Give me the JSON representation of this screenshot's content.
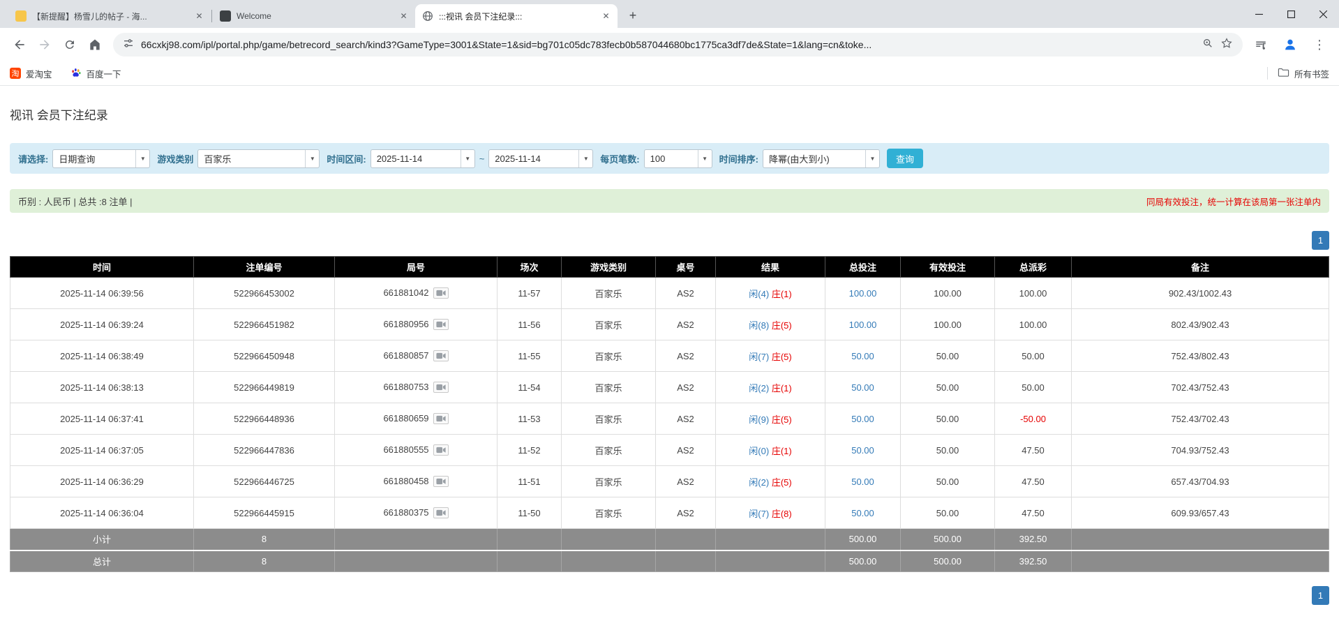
{
  "browser": {
    "tabs": [
      {
        "title": "【新提醒】杨雪儿的帖子 - 海...",
        "active": false
      },
      {
        "title": "Welcome",
        "active": false
      },
      {
        "title": ":::视讯 会员下注纪录:::",
        "active": true
      }
    ],
    "url": "66cxkj98.com/ipl/portal.php/game/betrecord_search/kind3?GameType=3001&State=1&sid=bg701c05dc783fecb0b587044680bc1775ca3df7de&State=1&lang=cn&toke...",
    "bookmarks": {
      "aitaobao_label": "爱淘宝",
      "aitaobao_glyph": "淘",
      "baidu_label": "百度一下",
      "all_bookmarks_label": "所有书签"
    }
  },
  "icons": {
    "tab_close": "✕",
    "new_tab": "+",
    "combo_arrow": "▼",
    "menu_dots": "⋮"
  },
  "page": {
    "title": "视讯 会员下注纪录",
    "filters": {
      "select_label": "请选择:",
      "select_value": "日期查询",
      "game_type_label": "游戏类别",
      "game_type_value": "百家乐",
      "range_label": "时间区间:",
      "date_from": "2025-11-14",
      "range_separator": "~",
      "date_to": "2025-11-14",
      "per_page_label": "每页笔数:",
      "per_page_value": "100",
      "sort_label": "时间排序:",
      "sort_value": "降幂(由大到小)",
      "search_button_label": "查询"
    },
    "info": {
      "summary": "币别 : 人民币 | 总共 :8 注单 |",
      "notice": "同局有效投注，统一计算在该局第一张注单内"
    },
    "pagination_label": "1",
    "colors": {
      "link_blue": "#337ab7",
      "banker_red": "#e60000",
      "negative_red": "#e60000",
      "filter_bg": "#d9edf7",
      "info_bg": "#dff0d8",
      "search_button_bg": "#31b0d5",
      "table_header_bg": "#000000",
      "summary_row_bg": "#8c8c8c",
      "pager_bg": "#337ab7"
    },
    "table": {
      "headers": [
        "时间",
        "注单编号",
        "局号",
        "场次",
        "游戏类别",
        "桌号",
        "结果",
        "总投注",
        "有效投注",
        "总派彩",
        "备注"
      ],
      "rows": [
        {
          "time": "2025-11-14 06:39:56",
          "bet_id": "522966453002",
          "round_id": "661881042",
          "session": "11-57",
          "game": "百家乐",
          "table_no": "AS2",
          "result_player": "闲(4)",
          "result_banker": "庄(1)",
          "total_bet": "100.00",
          "valid_bet": "100.00",
          "payout": "100.00",
          "note": "902.43/1002.43"
        },
        {
          "time": "2025-11-14 06:39:24",
          "bet_id": "522966451982",
          "round_id": "661880956",
          "session": "11-56",
          "game": "百家乐",
          "table_no": "AS2",
          "result_player": "闲(8)",
          "result_banker": "庄(5)",
          "total_bet": "100.00",
          "valid_bet": "100.00",
          "payout": "100.00",
          "note": "802.43/902.43"
        },
        {
          "time": "2025-11-14 06:38:49",
          "bet_id": "522966450948",
          "round_id": "661880857",
          "session": "11-55",
          "game": "百家乐",
          "table_no": "AS2",
          "result_player": "闲(7)",
          "result_banker": "庄(5)",
          "total_bet": "50.00",
          "valid_bet": "50.00",
          "payout": "50.00",
          "note": "752.43/802.43"
        },
        {
          "time": "2025-11-14 06:38:13",
          "bet_id": "522966449819",
          "round_id": "661880753",
          "session": "11-54",
          "game": "百家乐",
          "table_no": "AS2",
          "result_player": "闲(2)",
          "result_banker": "庄(1)",
          "total_bet": "50.00",
          "valid_bet": "50.00",
          "payout": "50.00",
          "note": "702.43/752.43"
        },
        {
          "time": "2025-11-14 06:37:41",
          "bet_id": "522966448936",
          "round_id": "661880659",
          "session": "11-53",
          "game": "百家乐",
          "table_no": "AS2",
          "result_player": "闲(9)",
          "result_banker": "庄(5)",
          "total_bet": "50.00",
          "valid_bet": "50.00",
          "payout": "-50.00",
          "note": "752.43/702.43"
        },
        {
          "time": "2025-11-14 06:37:05",
          "bet_id": "522966447836",
          "round_id": "661880555",
          "session": "11-52",
          "game": "百家乐",
          "table_no": "AS2",
          "result_player": "闲(0)",
          "result_banker": "庄(1)",
          "total_bet": "50.00",
          "valid_bet": "50.00",
          "payout": "47.50",
          "note": "704.93/752.43"
        },
        {
          "time": "2025-11-14 06:36:29",
          "bet_id": "522966446725",
          "round_id": "661880458",
          "session": "11-51",
          "game": "百家乐",
          "table_no": "AS2",
          "result_player": "闲(2)",
          "result_banker": "庄(5)",
          "total_bet": "50.00",
          "valid_bet": "50.00",
          "payout": "47.50",
          "note": "657.43/704.93"
        },
        {
          "time": "2025-11-14 06:36:04",
          "bet_id": "522966445915",
          "round_id": "661880375",
          "session": "11-50",
          "game": "百家乐",
          "table_no": "AS2",
          "result_player": "闲(7)",
          "result_banker": "庄(8)",
          "total_bet": "50.00",
          "valid_bet": "50.00",
          "payout": "47.50",
          "note": "609.93/657.43"
        }
      ],
      "subtotal": {
        "label": "小计",
        "count": "8",
        "total_bet": "500.00",
        "valid_bet": "500.00",
        "payout": "392.50"
      },
      "grand_total": {
        "label": "总计",
        "count": "8",
        "total_bet": "500.00",
        "valid_bet": "500.00",
        "payout": "392.50"
      }
    }
  }
}
